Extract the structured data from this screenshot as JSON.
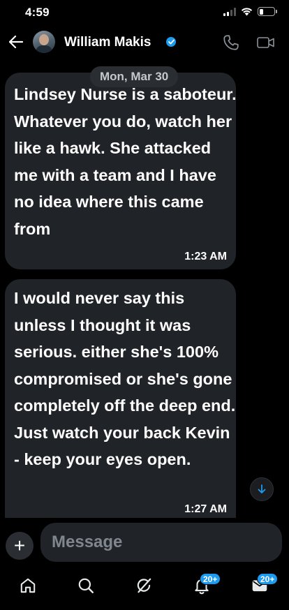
{
  "status_bar": {
    "time": "4:59",
    "battery_level": 0.25
  },
  "header": {
    "contact_name": "William Makis",
    "verified": true,
    "icons": [
      "back-arrow-icon",
      "verified-badge-icon",
      "phone-icon",
      "video-camera-icon"
    ]
  },
  "conversation": {
    "date_separator": "Mon, Mar 30",
    "messages": [
      {
        "text": "Lindsey Nurse is a saboteur. Whatever you do, watch her like a hawk. She attacked me with a team and I have no idea where this came from",
        "time": "1:23 AM"
      },
      {
        "text": "I would never say this unless I thought it was serious. either she's 100% compromised or she's gone completely off the deep end. Just watch your back Kevin - keep your eyes open.",
        "time": "1:27 AM"
      }
    ]
  },
  "composer": {
    "placeholder": "Message",
    "add_label": "+"
  },
  "bottom_nav": {
    "items": [
      "home-icon",
      "search-icon",
      "grok-icon",
      "notifications-icon",
      "messages-icon"
    ],
    "notifications_badge": "20+",
    "messages_badge": "20+"
  },
  "colors": {
    "background": "#000000",
    "bubble": "#202327",
    "accent": "#1d9bf0",
    "muted_text": "#7f868d"
  }
}
